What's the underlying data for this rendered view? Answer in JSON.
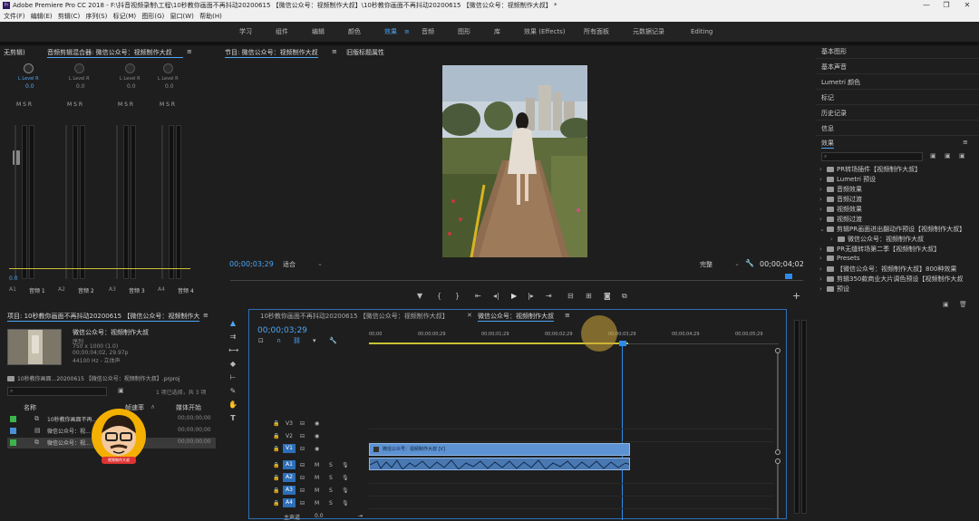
{
  "titlebar": {
    "icon": "Pr",
    "text": "Adobe Premiere Pro CC 2018 - F:\\抖音视频录制\\工程\\10秒教你画面不再抖动20200615 【微信公众号：视频制作大叔】\\10秒教你画面不再抖动20200615 【微信公众号：视频制作大叔】 *",
    "minimize": "—",
    "maximize": "❐",
    "close": "✕"
  },
  "menubar": [
    "文件(F)",
    "编辑(E)",
    "剪辑(C)",
    "序列(S)",
    "标记(M)",
    "图形(G)",
    "窗口(W)",
    "帮助(H)"
  ],
  "workspaces": [
    "学习",
    "组件",
    "编辑",
    "颜色",
    "效果",
    "音频",
    "图形",
    "库",
    "效果 (Effects)",
    "所有面板",
    "元数据记录",
    "Editing"
  ],
  "workspace_active": "效果",
  "mixer": {
    "tab_source": "无剪辑)",
    "tab_active": "音频剪辑混合器: 微信公众号：视频制作大叔",
    "menu_icon": "≡",
    "channels": [
      {
        "knob_label": "L   Level   R",
        "value": "0.0",
        "msr": [
          "M",
          "S",
          "R"
        ],
        "track": "A1",
        "name": "音频 1"
      },
      {
        "knob_label": "L   Level   R",
        "value": "0.0",
        "msr": [
          "M",
          "S",
          "R"
        ],
        "track": "A2",
        "name": "音频 2"
      },
      {
        "knob_label": "L   Level   R",
        "value": "0.0",
        "msr": [
          "M",
          "S",
          "R"
        ],
        "track": "A3",
        "name": "音频 3"
      },
      {
        "knob_label": "L   Level   R",
        "value": "0.0",
        "msr": [
          "M",
          "S",
          "R"
        ],
        "track": "A4",
        "name": "音频 4"
      }
    ],
    "scale": [
      "0",
      "-6",
      "-12",
      "-18",
      "-24",
      "-30",
      "-36",
      "-42",
      "-48",
      "-54",
      "dB"
    ],
    "master_value": "0.0"
  },
  "program": {
    "tab_active": "节目: 微信公众号：视频制作大叔",
    "tab_other": "旧版标题属性",
    "menu_icon": "≡",
    "timecode": "00;00;03;29",
    "fit": "适合",
    "quality": "完整",
    "duration": "00;00;04;02",
    "transport": [
      "marker-icon",
      "in-point-icon",
      "out-point-icon",
      "go-to-in-icon",
      "step-back-icon",
      "play-icon",
      "step-forward-icon",
      "go-to-out-icon",
      "insert-icon",
      "overwrite-icon",
      "export-frame-icon",
      "compare-icon"
    ],
    "add_button": "+"
  },
  "project": {
    "tab_active": "项目: 10秒教你画面不再抖动20200615 【微信公众号：视频制作大叔】",
    "menu_icon": "≡",
    "preview_name": "微信公众号：视频制作大叔",
    "preview_type": "序列",
    "preview_size": "750 x 1000 (1.0)",
    "preview_duration": "00;00;04;02, 29.97p",
    "preview_audio": "44100 Hz - 立体声",
    "project_file": "10秒教你画面...20200615 【微信公众号：视频制作大叔】.prproj",
    "search_placeholder": "",
    "selection_info": "1 项已选择，共 3 项",
    "columns": [
      "名称",
      "帧速率",
      "媒体开始"
    ],
    "items": [
      {
        "name": "10秒教你画面不再...",
        "start": "00;00;00;00",
        "color": "#3cb44b"
      },
      {
        "name": "微信公众号：视...",
        "start": "00;00;00;00",
        "color": "#4a8fd8"
      },
      {
        "name": "微信公众号：视...",
        "start": "00;00;00;00",
        "color": "#3cb44b"
      }
    ],
    "avatar_caption": "视频制作大叔"
  },
  "tools": [
    "selection-tool-icon",
    "track-select-icon",
    "ripple-edit-icon",
    "razor-icon",
    "slip-icon",
    "pen-icon",
    "hand-icon",
    "type-icon"
  ],
  "timeline": {
    "tab_inactive": "10秒教你画面不再抖动20200615 【微信公众号：视频制作大叔】",
    "tab_active": "微信公众号：视频制作大叔",
    "menu_icon": "≡",
    "timecode": "00;00;03;29",
    "ruler": [
      "00;00",
      "00;00;00;29",
      "00;00;01;29",
      "00;00;02;29",
      "00;00;03;29",
      "00;00;04;29",
      "00;00;05;29"
    ],
    "video_tracks": [
      "V3",
      "V2",
      "V1"
    ],
    "audio_tracks": [
      "A1",
      "A2",
      "A3",
      "A4"
    ],
    "master": "主声道",
    "master_value": "0.0",
    "clip_video": "微信公众号：视频制作大叔 [V]",
    "track_btns": [
      "M",
      "S"
    ],
    "playhead_fraction": 0.667
  },
  "right_panel": {
    "items": [
      "基本图形",
      "基本声音",
      "Lumetri 颜色",
      "标记",
      "历史记录",
      "信息"
    ],
    "effects_title": "效果",
    "menu_icon": "≡",
    "effects_tree": [
      {
        "label": "PR转场插件【视频制作大叔】",
        "indent": 0,
        "open": false
      },
      {
        "label": "Lumetri 预设",
        "indent": 0,
        "open": false
      },
      {
        "label": "音频效果",
        "indent": 0,
        "open": false
      },
      {
        "label": "音频过渡",
        "indent": 0,
        "open": false
      },
      {
        "label": "视频效果",
        "indent": 0,
        "open": false
      },
      {
        "label": "视频过渡",
        "indent": 0,
        "open": false
      },
      {
        "label": "剪辑PR画面进出翻动作预设【视频制作大叔】",
        "indent": 0,
        "open": true
      },
      {
        "label": "微信公众号：视频制作大叔",
        "indent": 1,
        "open": false
      },
      {
        "label": "PR无缝转场第二季【视频制作大叔】",
        "indent": 0,
        "open": false
      },
      {
        "label": "Presets",
        "indent": 0,
        "open": false
      },
      {
        "label": "【微信公众号：视频制作大叔】800种效果",
        "indent": 0,
        "open": false
      },
      {
        "label": "剪辑350款商业大片调色预设【视频制作大叔",
        "indent": 0,
        "open": false
      },
      {
        "label": "预设",
        "indent": 0,
        "open": false
      }
    ]
  }
}
